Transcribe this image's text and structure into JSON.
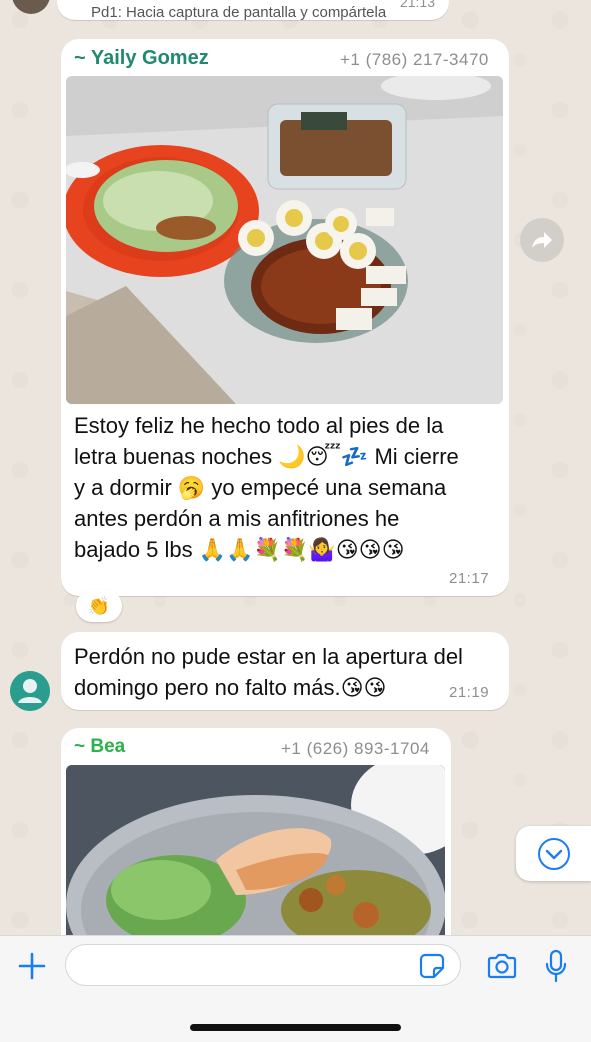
{
  "top_message": {
    "text": "Pd1: Hacia captura de pantalla y compártela",
    "time": "21:13"
  },
  "message1": {
    "sender": "~ Yaily Gomez",
    "phone": "+1 (786) 217-3470",
    "lines": [
      "Estoy feliz he hecho todo al pies de la",
      "letra buenas noches 🌙😴💤 Mi cierre",
      "y a dormir 🥱 yo empecé una semana",
      "antes perdón a mis anfitriones he",
      "bajado 5 lbs 🙏🙏💐💐🤷‍♀️😘😘😘"
    ],
    "time": "21:17",
    "reaction": "👏"
  },
  "message2": {
    "lines": [
      "Perdón no pude estar en la apertura del",
      "domingo pero no falto más.😘😘"
    ],
    "time": "21:19"
  },
  "message3": {
    "sender": "~ Bea",
    "phone": "+1 (626) 893-1704"
  },
  "colors": {
    "sender1": "#1f8a70",
    "sender2": "#2bb34a",
    "accent_blue": "#1a7df4",
    "chat_bg": "#ece5dd"
  },
  "icons": {
    "add": "plus-icon",
    "sticker": "sticker-icon",
    "camera": "camera-icon",
    "mic": "microphone-icon",
    "forward": "forward-icon",
    "scroll": "chevron-down-icon"
  }
}
